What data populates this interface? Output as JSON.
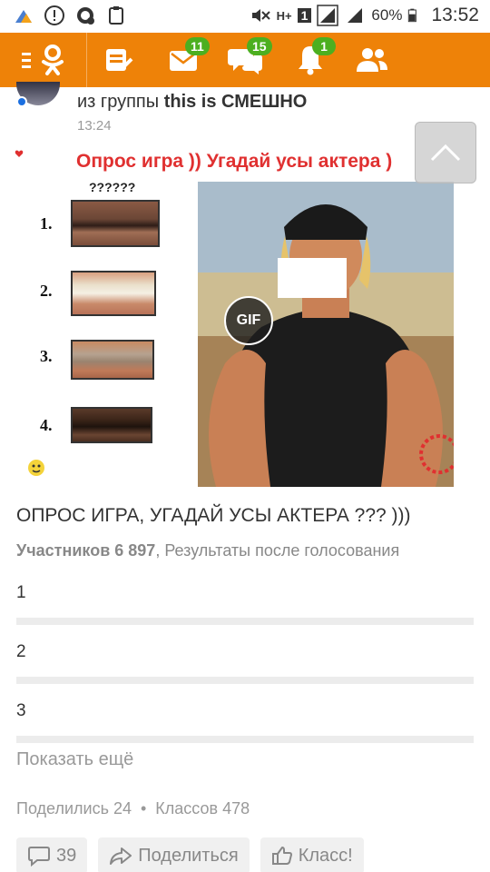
{
  "status_bar": {
    "battery_percent": "60%",
    "time": "13:52",
    "network": "H+",
    "sim": "1",
    "icons": [
      "app-notification-icon",
      "alert-icon",
      "whatsapp-icon",
      "clipboard-icon",
      "mute-icon",
      "data-arrows-icon",
      "sim-icon",
      "signal-icon",
      "signal-icon",
      "battery-icon"
    ]
  },
  "toolbar": {
    "brand_color": "#ee8208",
    "badge_color": "#4caf20",
    "messages_badge": "11",
    "discussions_badge": "15",
    "notifications_badge": "1"
  },
  "post": {
    "group_prefix": "из группы ",
    "group_name": "this is СМЕШНО",
    "time": "13:24"
  },
  "media": {
    "image_title": "Опрос игра )) Угадай усы актера )",
    "question_marks": "??????",
    "numbers": [
      "1.",
      "2.",
      "3.",
      "4."
    ],
    "gif_label": "GIF"
  },
  "poll": {
    "title": "ОПРОС ИГРА, УГАДАЙ УСЫ АКТЕРА ??? )))",
    "participants": "Участников 6 897",
    "results_note": ", Результаты после голосования",
    "options": [
      "1",
      "2",
      "3"
    ],
    "show_more": "Показать ещё"
  },
  "stats": {
    "shared": "Поделились 24",
    "separator": "•",
    "likes": "Классов 478"
  },
  "actions": {
    "comments_count": "39",
    "share_label": "Поделиться",
    "like_label": "Класс!"
  }
}
